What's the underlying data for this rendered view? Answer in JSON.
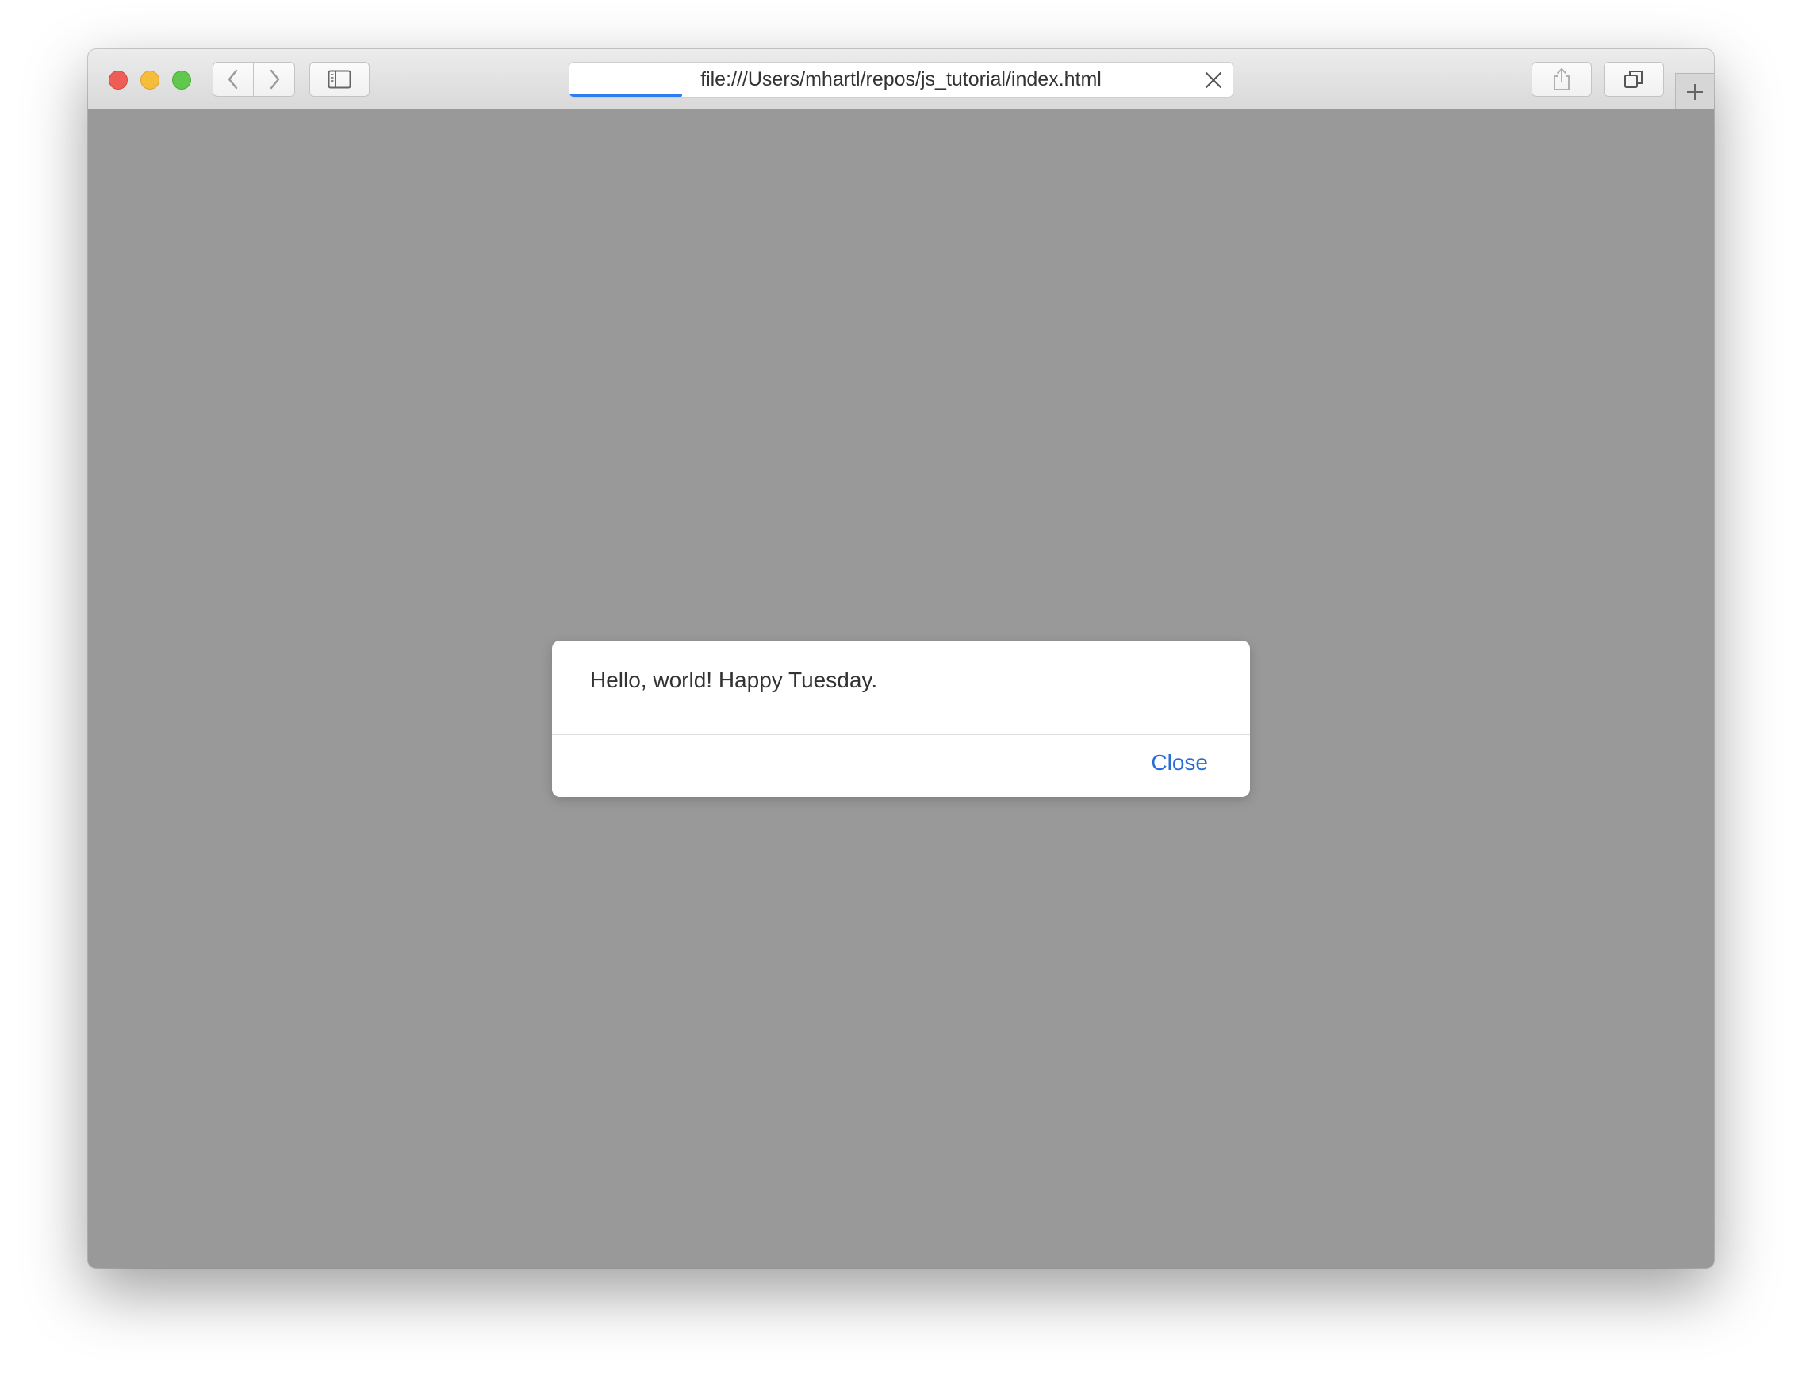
{
  "browser": {
    "url": "file:///Users/mhartl/repos/js_tutorial/index.html",
    "load_progress_percent": 17,
    "accent_color": "#2f7cf0",
    "icons": {
      "close": "close-window",
      "minimize": "minimize-window",
      "maximize": "maximize-window",
      "back": "chevron-left",
      "forward": "chevron-right",
      "sidebar": "sidebar",
      "stop": "x-mark",
      "share": "share",
      "tabs": "tab-overview",
      "new_tab": "plus"
    }
  },
  "dialog": {
    "message": "Hello, world! Happy Tuesday.",
    "close_label": "Close",
    "link_color": "#2a6cd6"
  }
}
